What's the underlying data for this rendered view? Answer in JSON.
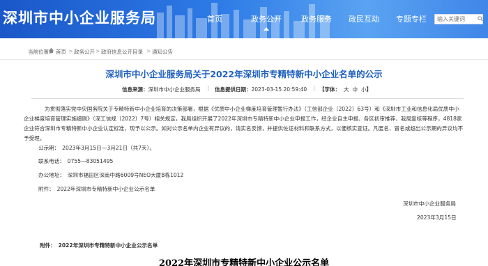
{
  "header": {
    "logo": "深圳市中小企业服务局",
    "nav": [
      {
        "label": "首页"
      },
      {
        "label": "政务公开"
      },
      {
        "label": "政务服务"
      },
      {
        "label": "政民互动"
      },
      {
        "label": "专题专栏"
      }
    ],
    "active_nav": "政务公开",
    "search_placeholder": "输入关键词",
    "colors": {
      "primary": "#1a57c9",
      "title_blue": "#1e5fbf"
    }
  },
  "breadcrumb": {
    "prefix": "当前位置：",
    "items": [
      "首页",
      "政务公开",
      "政府信息公开目录",
      "通知公告"
    ],
    "separator": ">"
  },
  "article": {
    "title": "深圳市中小企业服务局关于2022年深圳市专精特新中小企业名单的公示",
    "source_label": "信息来源：",
    "source_value": "深圳市中小企业服务局",
    "date_label": "信息提供日期：",
    "date_value": "2023-03-15 20:59:40",
    "font_label": "【字体：",
    "font_options": [
      "大",
      "中",
      "小"
    ],
    "font_close": "】",
    "paragraph": "为贯彻落实党中央国务院关于专精特新中小企业培育的决策部署，根据《优质中小企业梯度培育管理暂行办法》（工信部企业〔2022〕63号）和《深圳市工业和信息化局优质中小企业梯度培育管理实施细则》（深工信规〔2022〕7号）相关规定，我局组织开展了2022年深圳市专精特新中小企业申报工作，经企业自主申报、各区初审推荐、我局复核等程序，4818家企业符合深圳市专精特新中小企业认定标准，现予以公示。如对公示名单内企业有异议的，请实名反馈，并提供佐证材料和联系方式，以便核实查证。凡匿名、冒名或超出公示期的异议均不予受理。",
    "period": "公示期：　2023年3月15日—3月21日（共7天）。",
    "phone": "联系电话：　0755—83051495",
    "address": "办公地址：　深圳市福田区深南中路6009号NEO大厦B栋1012",
    "attachment": "附件：　2022年深圳市专精特新中小企业公示名单",
    "sign_org": "深圳市中小企业服务局",
    "sign_date": "2023年3月15日",
    "attachment_bold": "附件：　2022年深圳市专精特新中小企业公示名单",
    "list_title": "2022年深圳市专精特新中小企业公示名单"
  }
}
